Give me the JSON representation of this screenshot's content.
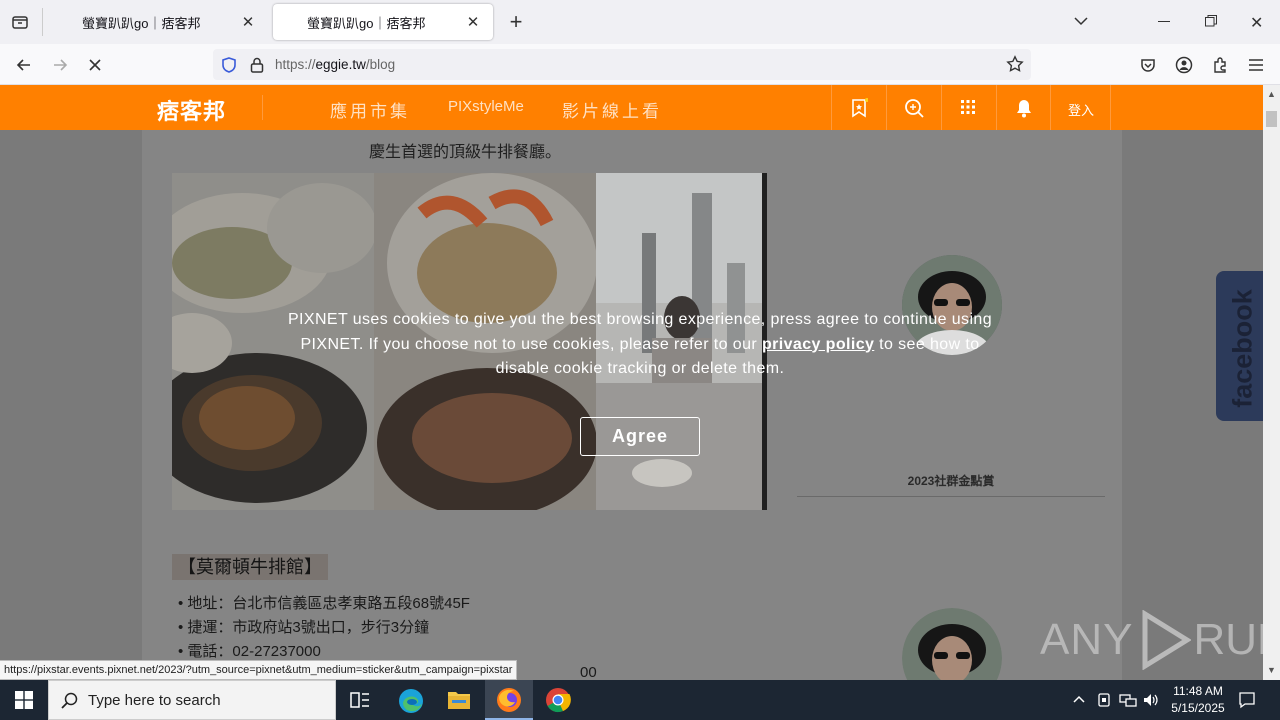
{
  "browser": {
    "tabs": [
      {
        "title": "螢寶趴趴go｜痞客邦",
        "active": false
      },
      {
        "title": "螢寶趴趴go｜痞客邦",
        "active": true
      }
    ],
    "new_tab_symbol": "+",
    "url_prefix": "https://",
    "url_host": "eggie.tw",
    "url_path": "/blog"
  },
  "site": {
    "logo": "痞客邦",
    "nav": [
      "應用市集",
      "PIXstyleMe",
      "影片線上看"
    ],
    "login": "登入",
    "colors": {
      "brand": "#ff8000"
    }
  },
  "article": {
    "intro_line": "慶生首選的頂級牛排餐廳。",
    "heading": "【莫爾頓牛排館】",
    "bullets": [
      "• 地址：台北市信義區忠孝東路五段68號45F",
      "• 捷運：市政府站3號出口，步行3分鐘",
      "• 電話：02-27237000"
    ],
    "hours_fragment": "00"
  },
  "sidebar": {
    "award_label": "2023社群金點賞",
    "facebook": "facebook"
  },
  "cookie": {
    "text_before": "PIXNET uses cookies to give you the best browsing experience, press agree to continue using PIXNET. If you choose not to use cookies, please refer to our",
    "link": "privacy policy",
    "text_after": "to see how to disable cookie tracking or delete them.",
    "agree": "Agree"
  },
  "status_url": "https://pixstar.events.pixnet.net/2023/?utm_source=pixnet&utm_medium=sticker&utm_campaign=pixstar",
  "watermark": "ANY RUN",
  "taskbar": {
    "search_placeholder": "Type here to search",
    "time": "11:48 AM",
    "date": "5/15/2025"
  }
}
